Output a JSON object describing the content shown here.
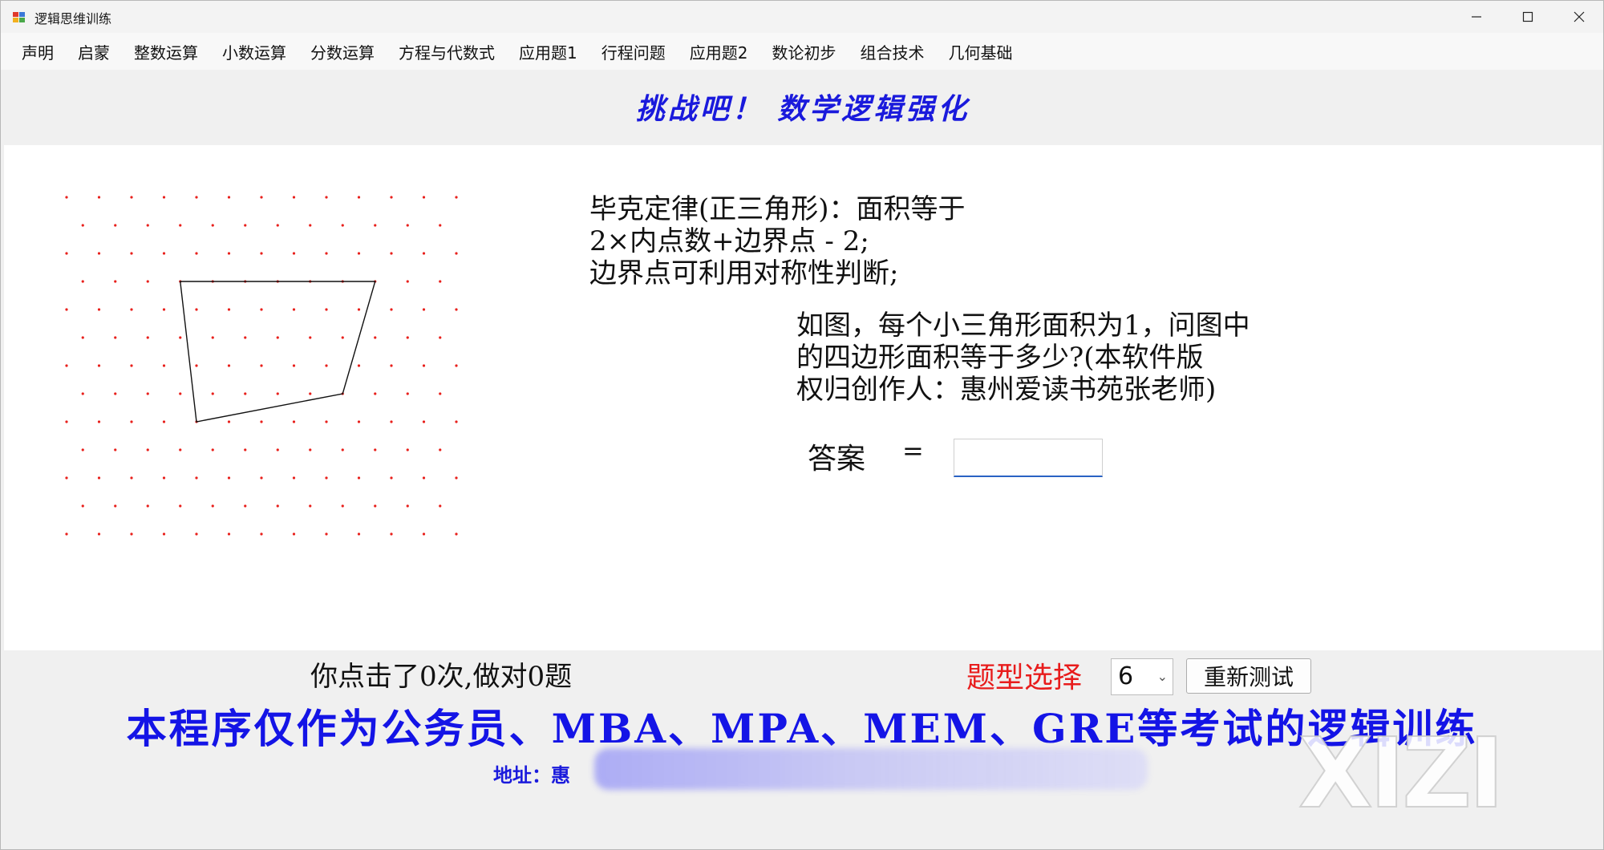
{
  "window": {
    "title": "逻辑思维训练",
    "icons": {
      "app": "app-icon",
      "minimize": "minimize-icon",
      "maximize": "maximize-icon",
      "close": "close-icon"
    }
  },
  "menu": {
    "items": [
      "声明",
      "启蒙",
      "整数运算",
      "小数运算",
      "分数运算",
      "方程与代数式",
      "应用题1",
      "行程问题",
      "应用题2",
      "数论初步",
      "组合技术",
      "几何基础"
    ]
  },
  "header": {
    "title": "挑战吧！ 数学逻辑强化"
  },
  "figure": {
    "dot_color": "#e8201c",
    "polygon_vertices_grid": [
      [
        3,
        3
      ],
      [
        9,
        3
      ],
      [
        8,
        7
      ],
      [
        4,
        8
      ]
    ]
  },
  "problem": {
    "rule_text": "毕克定律(正三角形)：面积等于\n2×内点数+边界点 - 2;\n边界点可利用对称性判断;",
    "question_text": "如图，每个小三角形面积为1，问图中\n的四边形面积等于多少?(本软件版\n权归创作人：惠州爱读书苑张老师)",
    "answer_label": "答案",
    "equals": "=",
    "answer_value": ""
  },
  "status": {
    "click_count_text": "你点击了0次,做对0题",
    "type_label": "题型选择",
    "type_selected": "6",
    "retest_label": "重新测试"
  },
  "footer": {
    "banner": "本程序仅作为公务员、MBA、MPA、MEM、GRE等考试的逻辑训练",
    "address_prefix": "地址：惠",
    "watermark": "XIZI"
  },
  "colors": {
    "accent_blue": "#1a1adc",
    "label_red": "#e81c1c"
  }
}
